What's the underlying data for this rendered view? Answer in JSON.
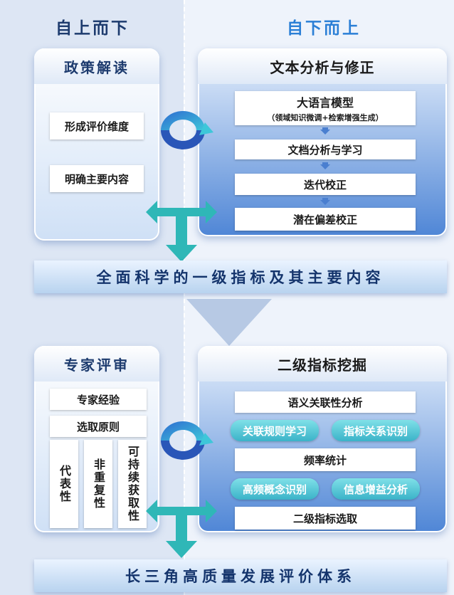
{
  "columns": {
    "left_title": "自上而下",
    "right_title": "自下而上"
  },
  "colors": {
    "left_title": "#1d3b6e",
    "right_title": "#2b7fd6",
    "accent_arrow": "#2fb7b7"
  },
  "policy_panel": {
    "title": "政策解读",
    "items": [
      "形成评价维度",
      "明确主要内容"
    ]
  },
  "text_panel": {
    "title": "文本分析与修正",
    "llm_title": "大语言模型",
    "llm_subtitle": "（领域知识微调+检索增强生成）",
    "steps": [
      "文档分析与学习",
      "迭代校正",
      "潜在偏差校正"
    ]
  },
  "banner1": "全面科学的一级指标及其主要内容",
  "expert_panel": {
    "title": "专家评审",
    "items": [
      "专家经验",
      "选取原则"
    ],
    "principles": [
      "代表性",
      "非重复性",
      "可持续获取性"
    ]
  },
  "mining_panel": {
    "title": "二级指标挖掘",
    "semantic": "语义关联性分析",
    "pair1": [
      "关联规则学习",
      "指标关系识别"
    ],
    "frequency": "频率统计",
    "pair2": [
      "高频概念识别",
      "信息增益分析"
    ],
    "selection": "二级指标选取"
  },
  "banner2": "长三角高质量发展评价体系"
}
